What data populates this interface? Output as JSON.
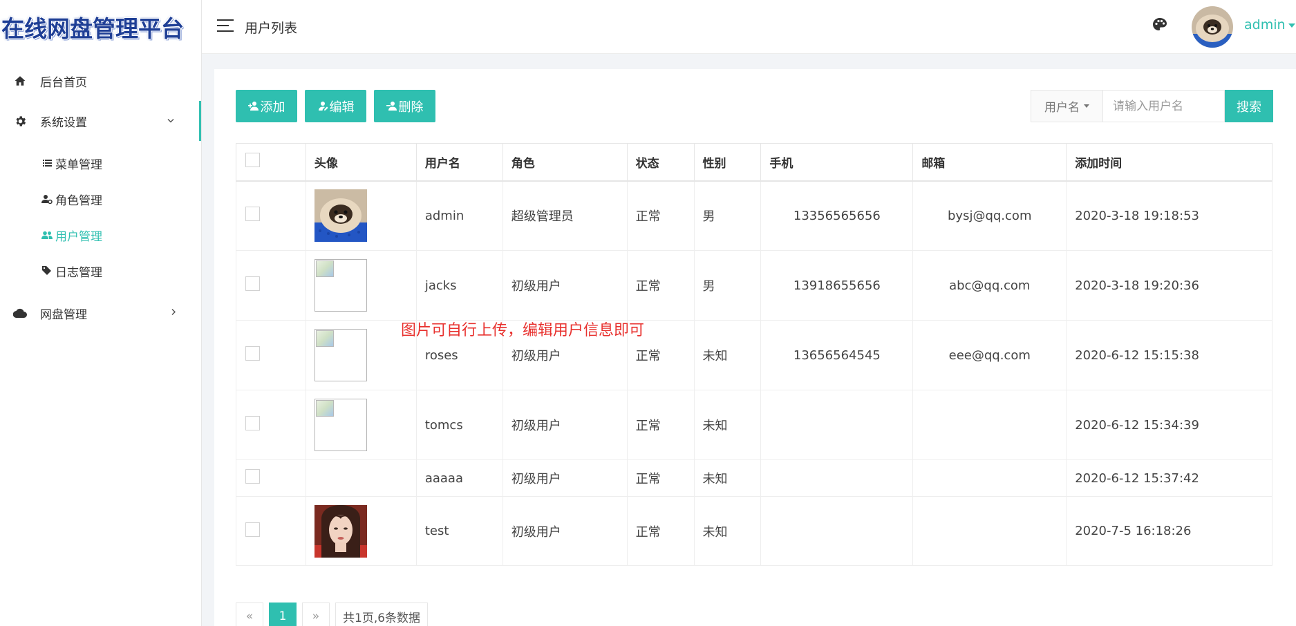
{
  "logo": {
    "text": "在线网盘管理平台"
  },
  "header": {
    "title": "用户列表",
    "user": "admin"
  },
  "sidebar": {
    "items": [
      {
        "label": "后台首页",
        "icon": "home-icon"
      },
      {
        "label": "系统设置",
        "icon": "gear-icon",
        "expanded": true,
        "children": [
          {
            "label": "菜单管理",
            "icon": "list-icon"
          },
          {
            "label": "角色管理",
            "icon": "user-gear-icon"
          },
          {
            "label": "用户管理",
            "icon": "users-icon",
            "active": true
          },
          {
            "label": "日志管理",
            "icon": "tag-icon"
          }
        ]
      },
      {
        "label": "网盘管理",
        "icon": "cloud-icon"
      }
    ]
  },
  "toolbar": {
    "add": "添加",
    "edit": "编辑",
    "delete": "删除"
  },
  "search": {
    "field": "用户名",
    "placeholder": "请输入用户名",
    "button": "搜索"
  },
  "table": {
    "headers": [
      "头像",
      "用户名",
      "角色",
      "状态",
      "性别",
      "手机",
      "邮箱",
      "添加时间"
    ],
    "rows": [
      {
        "avatar": "dog",
        "username": "admin",
        "role": "超级管理员",
        "status": "正常",
        "gender": "男",
        "phone": "13356565656",
        "email": "bysj@qq.com",
        "time": "2020-3-18 19:18:53"
      },
      {
        "avatar": "broken",
        "username": "jacks",
        "role": "初级用户",
        "status": "正常",
        "gender": "男",
        "phone": "13918655656",
        "email": "abc@qq.com",
        "time": "2020-3-18 19:20:36"
      },
      {
        "avatar": "broken",
        "username": "roses",
        "role": "初级用户",
        "status": "正常",
        "gender": "未知",
        "phone": "13656564545",
        "email": "eee@qq.com",
        "time": "2020-6-12 15:15:38"
      },
      {
        "avatar": "broken",
        "username": "tomcs",
        "role": "初级用户",
        "status": "正常",
        "gender": "未知",
        "phone": "",
        "email": "",
        "time": "2020-6-12 15:34:39"
      },
      {
        "avatar": "none",
        "username": "aaaaa",
        "role": "初级用户",
        "status": "正常",
        "gender": "未知",
        "phone": "",
        "email": "",
        "time": "2020-6-12 15:37:42"
      },
      {
        "avatar": "girl",
        "username": "test",
        "role": "初级用户",
        "status": "正常",
        "gender": "未知",
        "phone": "",
        "email": "",
        "time": "2020-7-5 16:18:26"
      }
    ]
  },
  "annotation": "图片可自行上传，编辑用户信息即可",
  "pagination": {
    "prev": "«",
    "current": "1",
    "next": "»",
    "info": "共1页,6条数据"
  },
  "colors": {
    "accent": "#2fbfb0",
    "unknown": "#f0a020",
    "annotation": "#e8312e"
  }
}
